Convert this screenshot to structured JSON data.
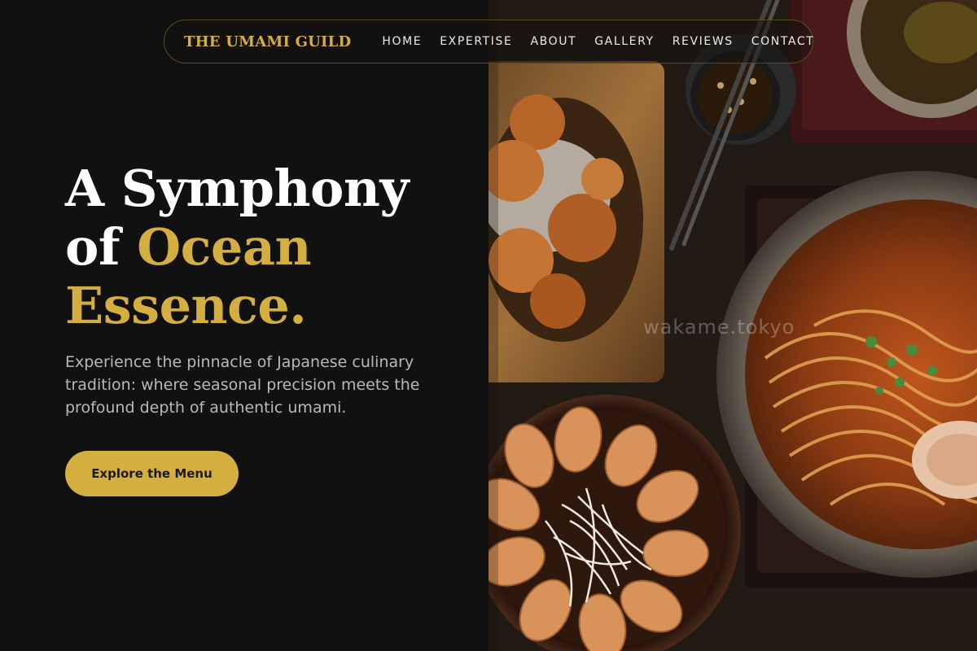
{
  "nav": {
    "brand": "THE UMAMI GUILD",
    "links": [
      "HOME",
      "EXPERTISE",
      "ABOUT",
      "GALLERY",
      "REVIEWS",
      "CONTACT"
    ]
  },
  "hero": {
    "title_line1": "A Symphony",
    "title_line2_prefix": "of ",
    "title_line2_accent": "Ocean",
    "title_line3": "Essence.",
    "description": "Experience the pinnacle of Japanese culinary tradition: where seasonal precision meets the profound depth of authentic umami.",
    "cta_label": "Explore the Menu"
  },
  "image": {
    "watermark": "wakame.tokyo",
    "subject": "overhead view of ramen bowl, gyoza, karaage and chopsticks on dark wood"
  },
  "colors": {
    "accent": "#d4ae3f",
    "background": "#111111",
    "muted_text": "#b9b9b9"
  }
}
